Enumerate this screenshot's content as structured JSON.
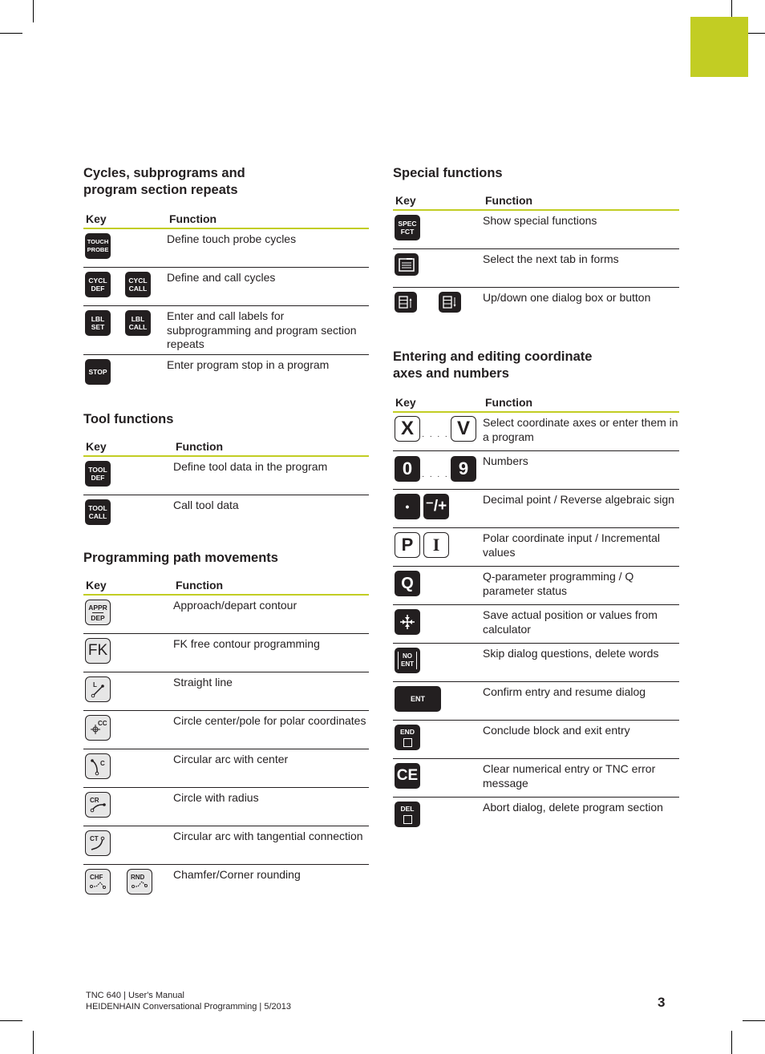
{
  "page": {
    "tab_color": "#c2cd23",
    "footer": {
      "line1": "TNC 640 | User's Manual",
      "line2": "HEIDENHAIN Conversational Programming | 5/2013"
    },
    "page_number": "3"
  },
  "headers": {
    "key": "Key",
    "function": "Function"
  },
  "sections": {
    "cycles": {
      "title_line1": "Cycles, subprograms and",
      "title_line2": "program section repeats",
      "rows": [
        {
          "keys": [
            [
              "TOUCH",
              "PROBE"
            ]
          ],
          "function": "Define touch probe cycles"
        },
        {
          "keys": [
            [
              "CYCL",
              "DEF"
            ],
            [
              "CYCL",
              "CALL"
            ]
          ],
          "function": "Define and call cycles"
        },
        {
          "keys": [
            [
              "LBL",
              "SET"
            ],
            [
              "LBL",
              "CALL"
            ]
          ],
          "function": "Enter and call labels for subprogramming and program section repeats"
        },
        {
          "keys": [
            [
              "STOP"
            ]
          ],
          "function": "Enter program stop in a program"
        }
      ]
    },
    "tool": {
      "title": "Tool functions",
      "rows": [
        {
          "keys": [
            [
              "TOOL",
              "DEF"
            ]
          ],
          "function": "Define tool data in the program"
        },
        {
          "keys": [
            [
              "TOOL",
              "CALL"
            ]
          ],
          "function": "Call tool data"
        }
      ]
    },
    "path": {
      "title": "Programming path movements",
      "rows": [
        {
          "keys": [
            [
              "APPR",
              "DEP"
            ]
          ],
          "function": "Approach/depart contour"
        },
        {
          "keys": [
            [
              "FK"
            ]
          ],
          "function": "FK free contour programming"
        },
        {
          "keys": [
            [
              "L"
            ]
          ],
          "function": "Straight line"
        },
        {
          "keys": [
            [
              "CC"
            ]
          ],
          "function": "Circle center/pole for polar coordinates"
        },
        {
          "keys": [
            [
              "C"
            ]
          ],
          "function": "Circular arc with center"
        },
        {
          "keys": [
            [
              "CR"
            ]
          ],
          "function": "Circle with radius"
        },
        {
          "keys": [
            [
              "CT"
            ]
          ],
          "function": "Circular arc with tangential connection"
        },
        {
          "keys": [
            [
              "CHF"
            ],
            [
              "RND"
            ]
          ],
          "function": "Chamfer/Corner rounding"
        }
      ]
    },
    "special": {
      "title": "Special functions",
      "rows": [
        {
          "keys": [
            [
              "SPEC",
              "FCT"
            ]
          ],
          "function": "Show special functions"
        },
        {
          "keys": [
            "next-tab-icon"
          ],
          "function": "Select the next tab in forms"
        },
        {
          "keys": [
            "dialog-up-icon",
            "dialog-down-icon"
          ],
          "function": "Up/down one dialog box or button"
        }
      ]
    },
    "entering": {
      "title_line1": "Entering and editing coordinate",
      "title_line2": "axes and numbers",
      "rows": [
        {
          "keys": [
            "X",
            "V"
          ],
          "separator": ". . . .",
          "function": "Select coordinate axes or enter them in a program"
        },
        {
          "keys": [
            "0",
            "9"
          ],
          "separator": ". . . .",
          "function": "Numbers"
        },
        {
          "keys": [
            "•",
            "⁻/+"
          ],
          "function": "Decimal point / Reverse algebraic sign"
        },
        {
          "keys": [
            "P",
            "I"
          ],
          "function": "Polar coordinate input / Incremental values"
        },
        {
          "keys": [
            "Q"
          ],
          "function": "Q-parameter programming / Q parameter status"
        },
        {
          "keys": [
            "actual-position-icon"
          ],
          "function": "Save actual position or values from calculator"
        },
        {
          "keys": [
            [
              "NO",
              "ENT"
            ]
          ],
          "function": "Skip dialog questions, delete words"
        },
        {
          "keys": [
            "ENT"
          ],
          "function": "Confirm entry and resume dialog"
        },
        {
          "keys": [
            "END"
          ],
          "function": "Conclude block and exit entry"
        },
        {
          "keys": [
            "CE"
          ],
          "function": "Clear numerical entry or TNC error message"
        },
        {
          "keys": [
            "DEL"
          ],
          "function": "Abort dialog, delete program section"
        }
      ]
    }
  }
}
